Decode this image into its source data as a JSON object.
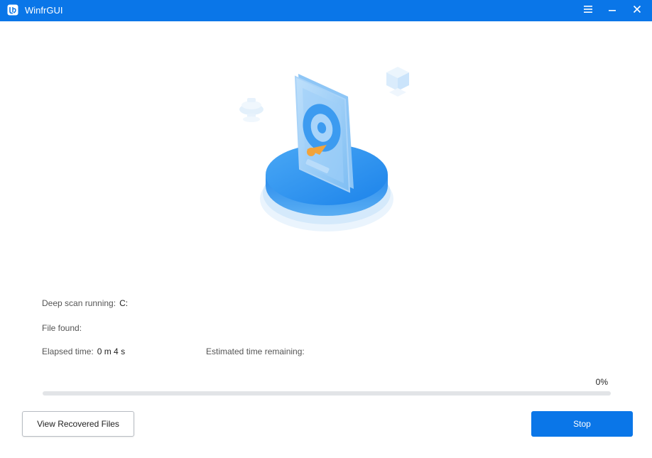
{
  "window": {
    "title": "WinfrGUI",
    "accent_color": "#0a76e8",
    "controls": [
      "menu-icon",
      "minimize-icon",
      "close-icon"
    ]
  },
  "scan": {
    "status_label": "Deep scan running",
    "separator": ":",
    "drive": "C:",
    "files_found_label": "File found",
    "elapsed_label": "Elapsed time",
    "elapsed_value": "0 m 4 s",
    "remaining_label": "Estimated time remaining",
    "remaining_value": ""
  },
  "progress": {
    "percent_text": "0%",
    "value": 0
  },
  "buttons": {
    "view_recovered": "View Recovered Files",
    "stop": "Stop"
  }
}
